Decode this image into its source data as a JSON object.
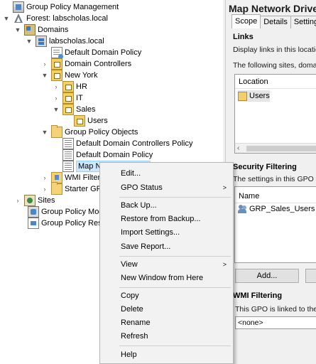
{
  "tree": {
    "items": [
      {
        "label": "Group Policy Management",
        "icon": "gpm-icon",
        "chevron": ""
      },
      {
        "label": "Forest: labscholas.local",
        "icon": "forest-icon",
        "chevron": "expanded"
      },
      {
        "label": "Domains",
        "icon": "domains-icon",
        "chevron": "expanded"
      },
      {
        "label": "labscholas.local",
        "icon": "domain-icon",
        "chevron": "expanded"
      },
      {
        "label": "Default Domain Policy",
        "icon": "gpo-link-icon",
        "chevron": ""
      },
      {
        "label": "Domain Controllers",
        "icon": "ou-icon",
        "chevron": "collapsed"
      },
      {
        "label": "New York",
        "icon": "ou-icon",
        "chevron": "expanded"
      },
      {
        "label": "HR",
        "icon": "ou-icon",
        "chevron": "collapsed"
      },
      {
        "label": "IT",
        "icon": "ou-icon",
        "chevron": "collapsed"
      },
      {
        "label": "Sales",
        "icon": "ou-icon",
        "chevron": "expanded"
      },
      {
        "label": "Users",
        "icon": "ou-icon",
        "chevron": ""
      },
      {
        "label": "Group Policy Objects",
        "icon": "folder-icon",
        "chevron": "expanded"
      },
      {
        "label": "Default Domain Controllers Policy",
        "icon": "gpo-icon",
        "chevron": ""
      },
      {
        "label": "Default Domain Policy",
        "icon": "gpo-icon",
        "chevron": ""
      },
      {
        "label": "Map Network Drives",
        "icon": "gpo-icon",
        "chevron": "",
        "selected": true
      },
      {
        "label": "WMI Filter",
        "icon": "wmi-folder-icon",
        "chevron": "collapsed"
      },
      {
        "label": "Starter GPO",
        "icon": "folder-icon",
        "chevron": "collapsed"
      },
      {
        "label": "Sites",
        "icon": "sites-icon",
        "chevron": "collapsed"
      },
      {
        "label": "Group Policy Mod",
        "icon": "modeling-icon",
        "chevron": ""
      },
      {
        "label": "Group Policy Resu",
        "icon": "results-icon",
        "chevron": ""
      }
    ]
  },
  "right": {
    "title": "Map Network Drives",
    "tabs": [
      "Scope",
      "Details",
      "Settings"
    ],
    "links_heading": "Links",
    "links_display_text": "Display links in this location:",
    "links_following_text": "The following sites, domains",
    "location_header": "Location",
    "location_row": "Users",
    "security_heading": "Security Filtering",
    "security_text": "The settings in this GPO can",
    "name_header": "Name",
    "security_row": "GRP_Sales_Users (LA",
    "add_button": "Add...",
    "wmi_heading": "WMI Filtering",
    "wmi_text": "This GPO is linked to the fol",
    "wmi_combo": "<none>"
  },
  "context_menu": {
    "items": [
      {
        "label": "Edit...",
        "submenu": false
      },
      {
        "label": "GPO Status",
        "submenu": true
      },
      {
        "label": "Back Up...",
        "submenu": false
      },
      {
        "label": "Restore from Backup...",
        "submenu": false
      },
      {
        "label": "Import Settings...",
        "submenu": false
      },
      {
        "label": "Save Report...",
        "submenu": false
      },
      {
        "label": "View",
        "submenu": true
      },
      {
        "label": "New Window from Here",
        "submenu": false
      },
      {
        "label": "Copy",
        "submenu": false
      },
      {
        "label": "Delete",
        "submenu": false
      },
      {
        "label": "Rename",
        "submenu": false
      },
      {
        "label": "Refresh",
        "submenu": false
      },
      {
        "label": "Help",
        "submenu": false
      }
    ],
    "highlight_color": "#fdfc2f"
  }
}
